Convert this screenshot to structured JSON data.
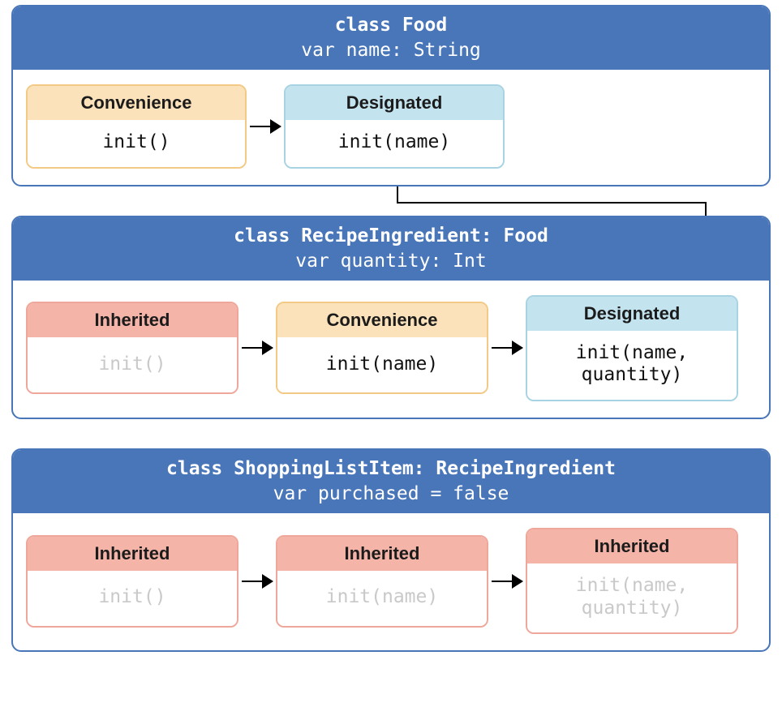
{
  "classes": {
    "food": {
      "title": "class Food",
      "subtitle": "var name: String",
      "inits": {
        "convenience": {
          "kind": "Convenience",
          "sig": "init()"
        },
        "designated": {
          "kind": "Designated",
          "sig": "init(name)"
        }
      }
    },
    "recipe": {
      "title": "class RecipeIngredient: Food",
      "subtitle": "var quantity: Int",
      "inits": {
        "inherited": {
          "kind": "Inherited",
          "sig": "init()"
        },
        "convenience": {
          "kind": "Convenience",
          "sig": "init(name)"
        },
        "designated": {
          "kind": "Designated",
          "sig": "init(name,\nquantity)"
        }
      }
    },
    "shopping": {
      "title": "class ShoppingListItem: RecipeIngredient",
      "subtitle": "var purchased = false",
      "inits": {
        "i0": {
          "kind": "Inherited",
          "sig": "init()"
        },
        "i1": {
          "kind": "Inherited",
          "sig": "init(name)"
        },
        "i2": {
          "kind": "Inherited",
          "sig": "init(name,\nquantity)"
        }
      }
    }
  }
}
